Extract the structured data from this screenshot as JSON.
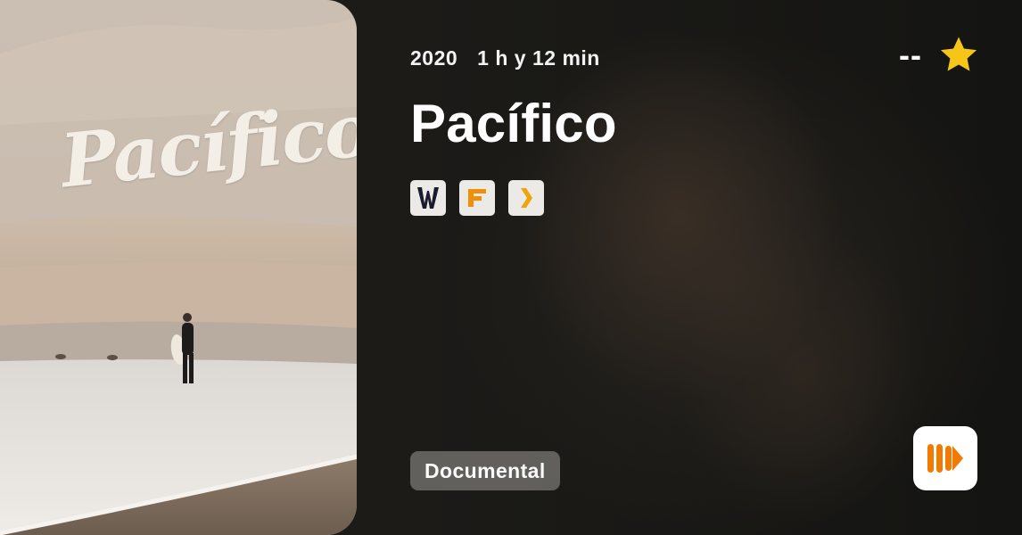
{
  "poster": {
    "title_art": "Pacífico",
    "icon": "poster-image"
  },
  "movie": {
    "year": "2020",
    "duration": "1 h y 12 min",
    "title": "Pacífico",
    "genre": "Documental"
  },
  "rating": {
    "value": "--",
    "icon": "star-icon",
    "star_color": "#f5c518"
  },
  "providers": [
    {
      "name": "provider-w",
      "letter": "W"
    },
    {
      "name": "provider-f",
      "letter": "F"
    },
    {
      "name": "provider-arrow",
      "letter": "❯"
    }
  ],
  "colors": {
    "provider_orange": "#f0900a",
    "app_orange": "#f27a00"
  }
}
